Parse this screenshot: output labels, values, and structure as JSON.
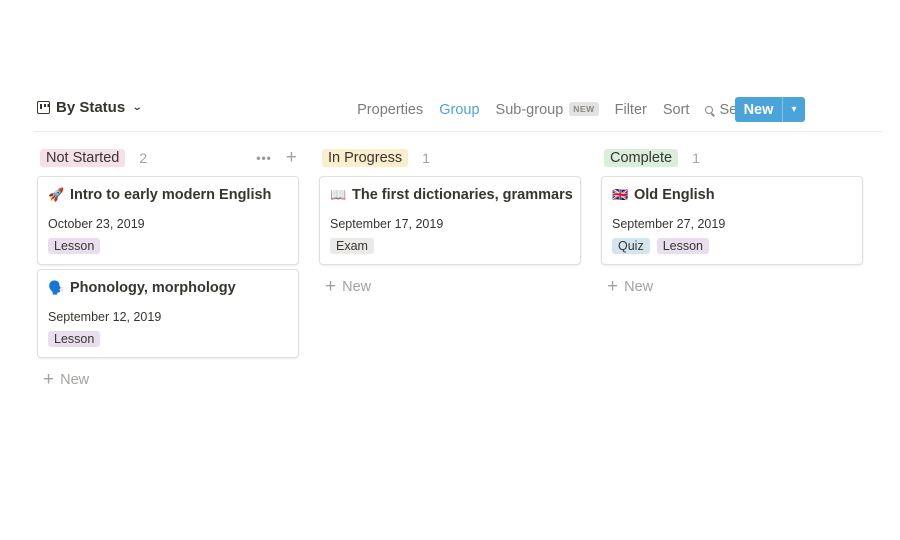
{
  "toolbar": {
    "view_name": "By Status",
    "view_icon": "board-icon",
    "actions": {
      "properties": "Properties",
      "group": "Group",
      "subgroup": "Sub-group",
      "subgroup_badge": "NEW",
      "filter": "Filter",
      "sort": "Sort",
      "search": "Search",
      "more": "•••"
    },
    "new_button": "New",
    "accent_color": "#4aa3d9"
  },
  "columns": [
    {
      "status": "Not Started",
      "count": "2",
      "pill_color": "#f5e0e9",
      "cards": [
        {
          "emoji": "🚀",
          "emoji_name": "rocket-icon",
          "title": "Intro to early modern English",
          "date": "October 23, 2019",
          "tags": [
            {
              "label": "Lesson",
              "color": "#e8deee"
            }
          ]
        },
        {
          "emoji": "🗣️",
          "emoji_name": "speaking-head-icon",
          "title": "Phonology, morphology",
          "date": "September 12, 2019",
          "tags": [
            {
              "label": "Lesson",
              "color": "#e8deee"
            }
          ]
        }
      ],
      "add_label": "New"
    },
    {
      "status": "In Progress",
      "count": "1",
      "pill_color": "#fbeecc",
      "cards": [
        {
          "emoji": "📖",
          "emoji_name": "open-book-icon",
          "title": "The first dictionaries, grammars",
          "date": "September 17, 2019",
          "tags": [
            {
              "label": "Exam",
              "color": "#ebeae8"
            }
          ]
        }
      ],
      "add_label": "New"
    },
    {
      "status": "Complete",
      "count": "1",
      "pill_color": "#dbeddb",
      "cards": [
        {
          "emoji": "🇬🇧",
          "emoji_name": "uk-flag-icon",
          "title": "Old English",
          "date": "September 27, 2019",
          "tags": [
            {
              "label": "Quiz",
              "color": "#d3e5ef"
            },
            {
              "label": "Lesson",
              "color": "#e8deee"
            }
          ]
        }
      ],
      "add_label": "New"
    }
  ]
}
